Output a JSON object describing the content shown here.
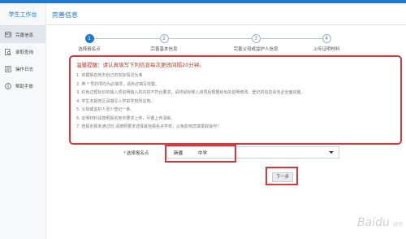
{
  "sidebar": {
    "title": "学生工作台",
    "items": [
      {
        "label": "完善信息",
        "icon": "id-card-icon",
        "active": true
      },
      {
        "label": "录取查询",
        "icon": "search-document-icon",
        "active": false
      },
      {
        "label": "操作日志",
        "icon": "log-icon",
        "active": false
      },
      {
        "label": "帮助手册",
        "icon": "info-icon",
        "active": false
      }
    ]
  },
  "main": {
    "title": "完善信息",
    "steps": [
      {
        "number": "1",
        "label": "选择报名点",
        "active": true
      },
      {
        "number": "2",
        "label": "完善基本信息",
        "active": false
      },
      {
        "number": "3",
        "label": "完善父母或监护人信息",
        "active": false
      },
      {
        "number": "4",
        "label": "上传证明材料",
        "active": false
      }
    ],
    "notice": {
      "title": "温馨提醒：请认真填写下列信息每次更改间隔20分钟。",
      "lines": [
        "1. 依据报名地市自己的实际情况为准",
        "2. 带 * 号的项均为必填项，请务必填写完整。",
        "3. 红色边框标识的输入项说明输入的内容不符合要求，请将鼠标移入该项后根据给出的说明修改。登记的信息请务必全面完整。",
        "4. 学生本报地区请填写入学前学校所在地。",
        "5. 父母或监护人至少登记一条。",
        "6. 证明材料请按照报名地市要求上传，尽量上传清晰。",
        "7. 若报省报未通过时,请按照要求选择其他报名点学校，以免影响您填录取操作！"
      ]
    },
    "form": {
      "select_label": "选择报名点",
      "required_mark": "*",
      "selected_value": "新疆",
      "selected_value_2": "中学"
    },
    "next_button": "下一步"
  },
  "watermark": {
    "text": "Baidu",
    "sub": "经验"
  },
  "colors": {
    "brand": "#1a7ad4",
    "alert": "#d9393d"
  }
}
